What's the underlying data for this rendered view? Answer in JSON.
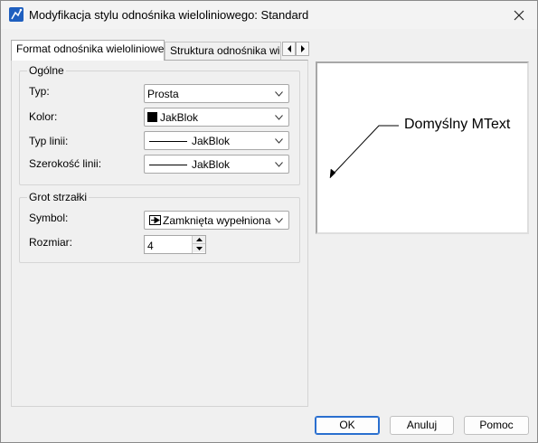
{
  "window": {
    "title": "Modyfikacja stylu odnośnika wieloliniowego: Standard"
  },
  "tabs": [
    {
      "label": "Format odnośnika wieloliniowego",
      "active": true
    },
    {
      "label": "Struktura odnośnika wielo",
      "active": false
    }
  ],
  "general": {
    "title": "Ogólne",
    "type": {
      "label": "Typ:",
      "value": "Prosta"
    },
    "color": {
      "label": "Kolor:",
      "value": "JakBlok",
      "swatch": "#000000"
    },
    "linetype": {
      "label": "Typ linii:",
      "value": "JakBlok"
    },
    "lineweight": {
      "label": "Szerokość linii:",
      "value": "JakBlok"
    }
  },
  "arrowhead": {
    "title": "Grot strzałki",
    "symbol": {
      "label": "Symbol:",
      "value": "Zamknięta wypełniona"
    },
    "size": {
      "label": "Rozmiar:",
      "value": "4"
    }
  },
  "preview": {
    "text": "Domyślny MText"
  },
  "buttons": {
    "ok": "OK",
    "cancel": "Anuluj",
    "help": "Pomoc"
  },
  "colors": {
    "accent": "#2a6fcf",
    "app_icon": "#1f5fbf"
  },
  "icons": {
    "app": "mleader-style-icon",
    "close": "close-icon",
    "tab_left": "chevron-left-icon",
    "tab_right": "chevron-right-icon",
    "dropdown": "chevron-down-icon",
    "spin_up": "spin-up-icon",
    "spin_down": "spin-down-icon"
  }
}
